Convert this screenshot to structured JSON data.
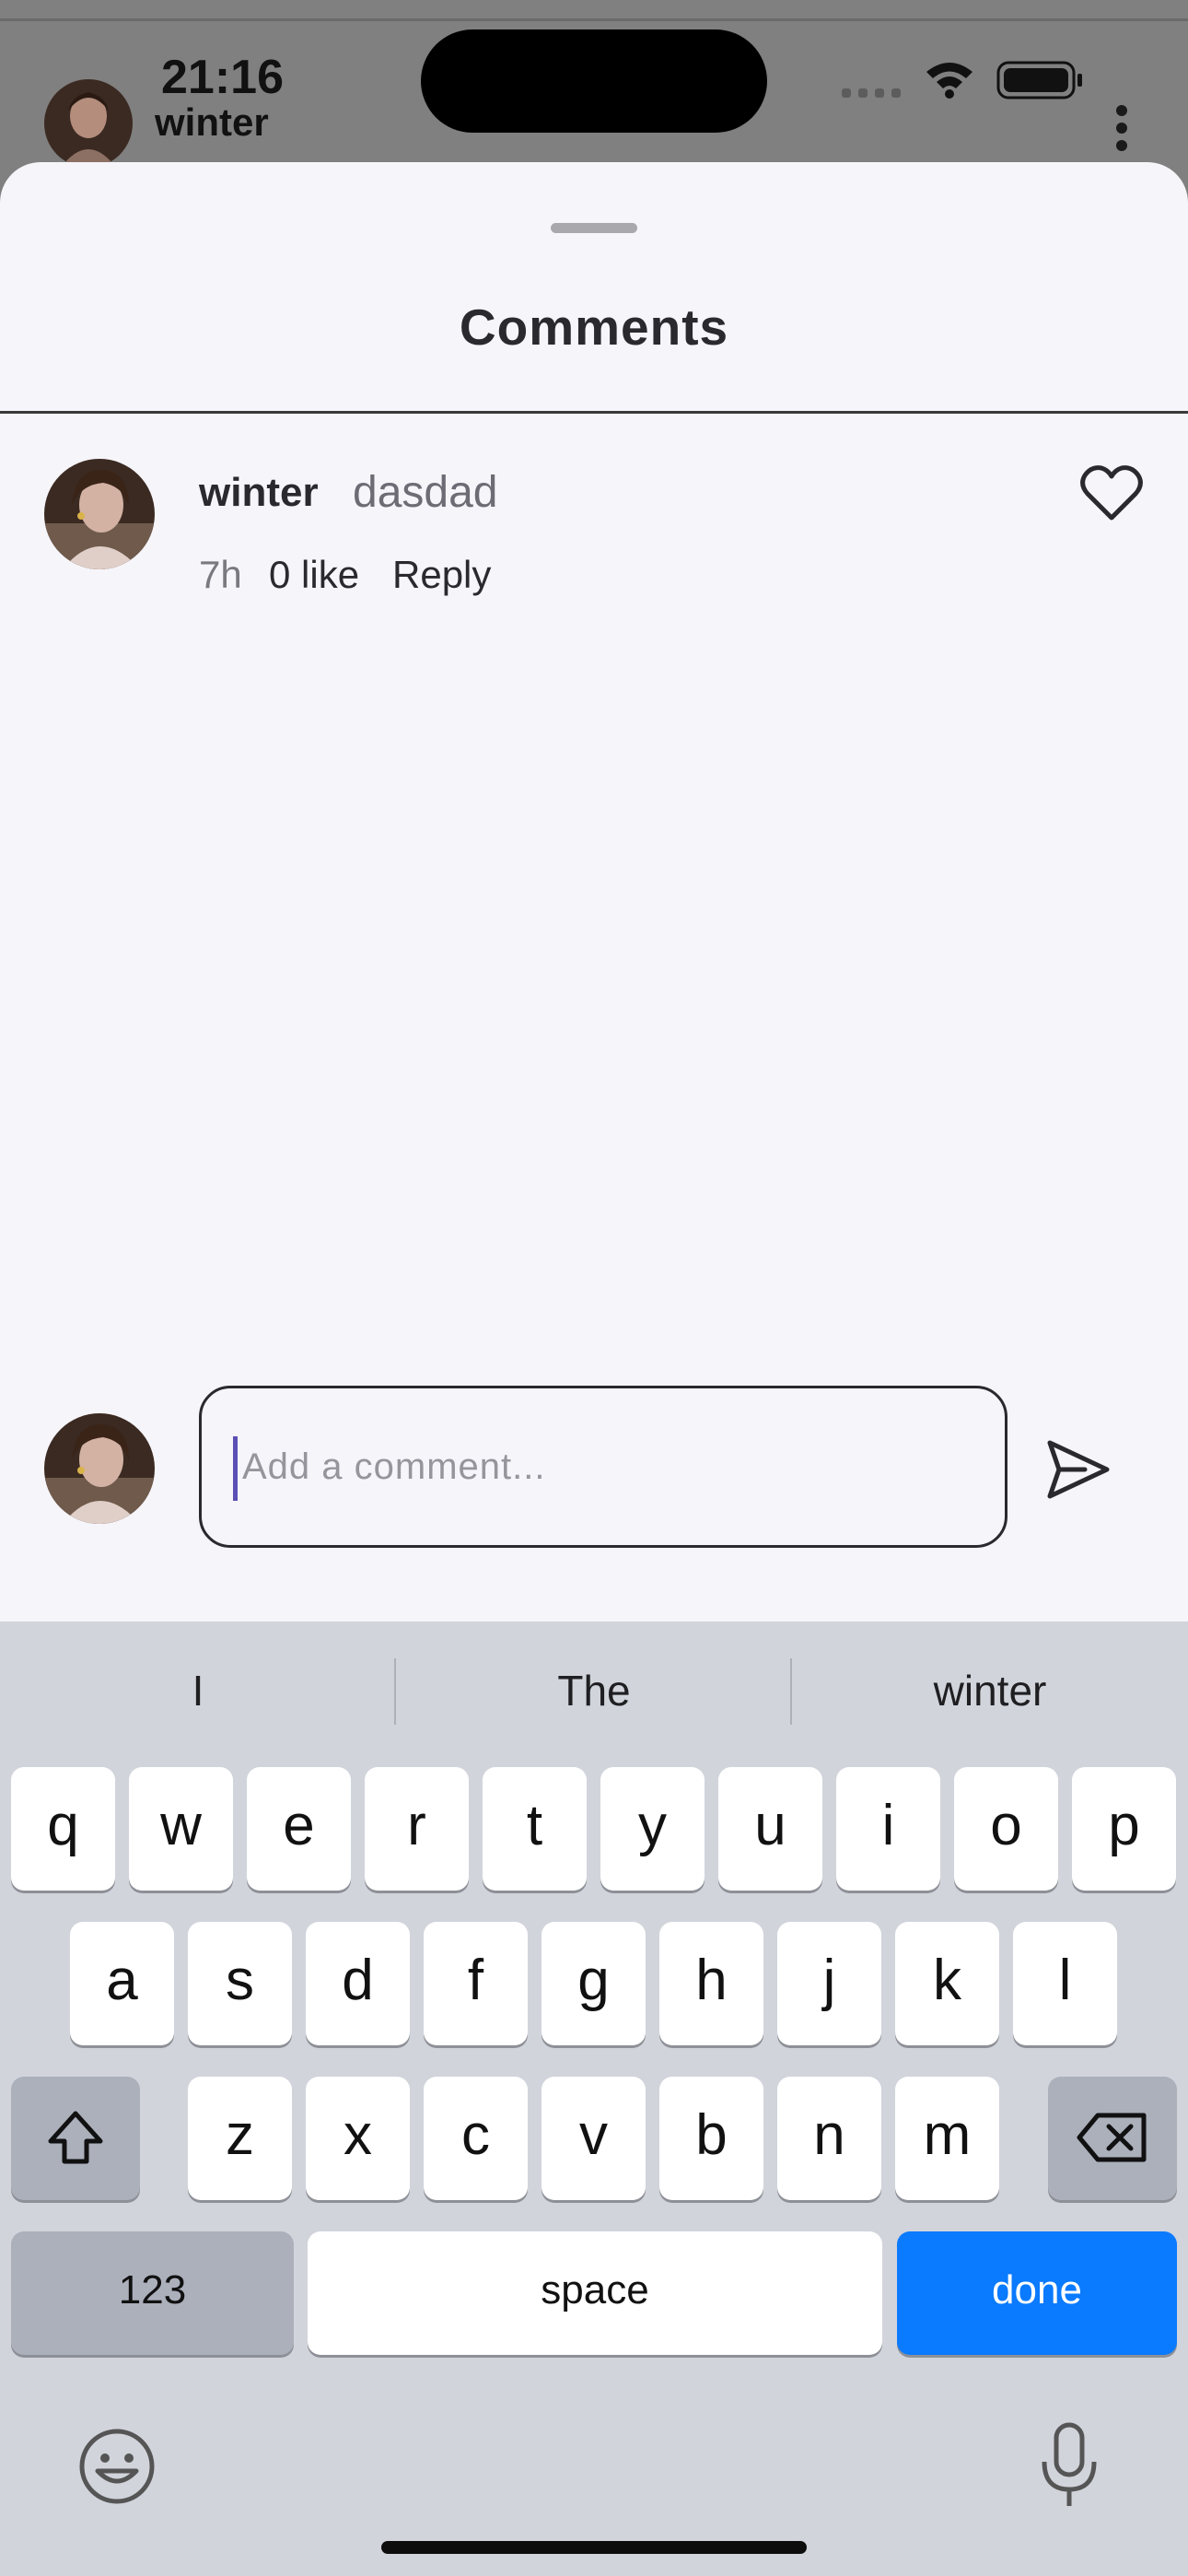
{
  "status_bar": {
    "time": "21:16"
  },
  "background_header": {
    "username": "winter"
  },
  "sheet": {
    "title": "Comments"
  },
  "comments": [
    {
      "username": "winter",
      "text": "dasdad",
      "time": "7h",
      "likes": "0 like",
      "reply_label": "Reply"
    }
  ],
  "composer": {
    "placeholder": "Add a comment...",
    "value": ""
  },
  "keyboard": {
    "suggestions": [
      "I",
      "The",
      "winter"
    ],
    "row1": [
      "q",
      "w",
      "e",
      "r",
      "t",
      "y",
      "u",
      "i",
      "o",
      "p"
    ],
    "row2": [
      "a",
      "s",
      "d",
      "f",
      "g",
      "h",
      "j",
      "k",
      "l"
    ],
    "row3": [
      "z",
      "x",
      "c",
      "v",
      "b",
      "n",
      "m"
    ],
    "numbers_label": "123",
    "space_label": "space",
    "done_label": "done"
  },
  "colors": {
    "accent": "#0a7aff",
    "sheet_bg": "#f6f5fa",
    "caret": "#5b4fb5"
  }
}
